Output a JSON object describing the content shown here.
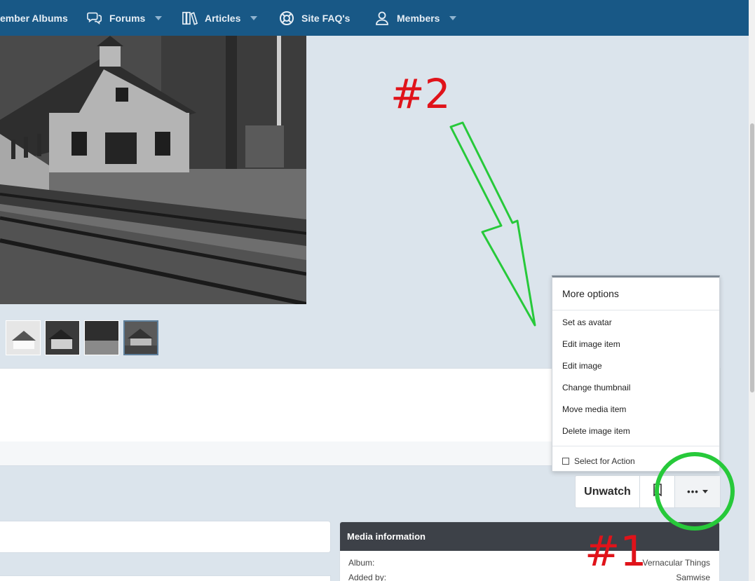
{
  "nav": {
    "items": [
      {
        "label": "ember Albums",
        "icon": "none"
      },
      {
        "label": "Forums",
        "icon": "chat-bubbles-icon"
      },
      {
        "label": "Articles",
        "icon": "books-icon"
      },
      {
        "label": "Site FAQ's",
        "icon": "lifebuoy-icon"
      },
      {
        "label": "Members",
        "icon": "user-icon"
      }
    ]
  },
  "menu": {
    "title": "More options",
    "items": [
      "Set as avatar",
      "Edit image item",
      "Edit image",
      "Change thumbnail",
      "Move media item",
      "Delete image item"
    ],
    "select_label": "Select for Action"
  },
  "actions": {
    "unwatch": "Unwatch",
    "more": "•••"
  },
  "media_info": {
    "title": "Media information",
    "rows": [
      {
        "label": "Album:",
        "value": "Vernacular Things"
      },
      {
        "label": "Added by:",
        "value": "Samwise"
      }
    ]
  },
  "annotations": {
    "one": "#1",
    "two": "#2"
  },
  "colors": {
    "nav_bg": "#185886",
    "page_bg": "#dbe4ec",
    "annotation_red": "#e0131a",
    "annotation_green": "#27c93a",
    "media_head_bg": "#3d4148"
  }
}
